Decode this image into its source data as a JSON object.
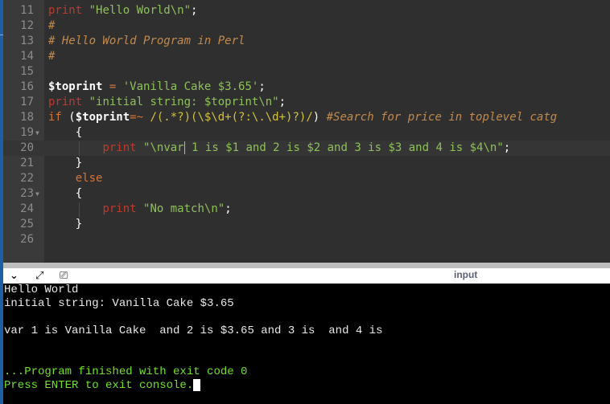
{
  "editor": {
    "lines": [
      {
        "num": "11",
        "tokens": [
          [
            "kw",
            "print"
          ],
          [
            "pl",
            " "
          ],
          [
            "str",
            "\"Hello World\\n\""
          ],
          [
            "pl",
            ";"
          ]
        ]
      },
      {
        "num": "12",
        "tokens": [
          [
            "cm",
            "#"
          ]
        ]
      },
      {
        "num": "13",
        "tokens": [
          [
            "cm",
            "# Hello World Program in Perl"
          ]
        ]
      },
      {
        "num": "14",
        "tokens": [
          [
            "cm",
            "#"
          ]
        ]
      },
      {
        "num": "15",
        "tokens": []
      },
      {
        "num": "16",
        "tokens": [
          [
            "var",
            "$toprint"
          ],
          [
            "pl",
            " "
          ],
          [
            "op",
            "="
          ],
          [
            "pl",
            " "
          ],
          [
            "str",
            "'Vanilla Cake $3.65'"
          ],
          [
            "pl",
            ";"
          ]
        ]
      },
      {
        "num": "17",
        "tokens": [
          [
            "kw",
            "print"
          ],
          [
            "pl",
            " "
          ],
          [
            "str",
            "\"initial string: $toprint\\n\""
          ],
          [
            "pl",
            ";"
          ]
        ]
      },
      {
        "num": "18",
        "tokens": [
          [
            "kw2",
            "if"
          ],
          [
            "pl",
            " ("
          ],
          [
            "var",
            "$toprint"
          ],
          [
            "op",
            "=~"
          ],
          [
            "pl",
            " "
          ],
          [
            "rx",
            "/(.*?)(\\$\\d+(?:\\.\\d+)?)/"
          ],
          [
            "pl",
            ")"
          ],
          [
            "pl",
            " "
          ],
          [
            "cm",
            "#Search for price in toplevel catg"
          ]
        ]
      },
      {
        "num": "19",
        "fold": true,
        "tokens": [
          [
            "pl",
            "    {"
          ]
        ]
      },
      {
        "num": "20",
        "active": true,
        "tokens": [
          [
            "pl",
            "        "
          ],
          [
            "kw",
            "print"
          ],
          [
            "pl",
            " "
          ],
          [
            "str",
            "\"\\nvar"
          ],
          [
            "cursor",
            ""
          ],
          [
            "str",
            " 1 is $1 and 2 is $2 and 3 is $3 and 4 is $4\\n\""
          ],
          [
            "pl",
            ";"
          ]
        ]
      },
      {
        "num": "21",
        "tokens": [
          [
            "pl",
            "    }"
          ]
        ]
      },
      {
        "num": "22",
        "tokens": [
          [
            "pl",
            "    "
          ],
          [
            "kw2",
            "else"
          ]
        ]
      },
      {
        "num": "23",
        "fold": true,
        "tokens": [
          [
            "pl",
            "    {"
          ]
        ]
      },
      {
        "num": "24",
        "tokens": [
          [
            "pl",
            "        "
          ],
          [
            "kw",
            "print"
          ],
          [
            "pl",
            " "
          ],
          [
            "str",
            "\"No match\\n\""
          ],
          [
            "pl",
            ";"
          ]
        ]
      },
      {
        "num": "25",
        "tokens": [
          [
            "pl",
            "    }"
          ]
        ]
      },
      {
        "num": "26",
        "tokens": []
      }
    ]
  },
  "toolbar": {
    "collapse_icon": "chevron-down-icon",
    "expand_icon": "expand-icon",
    "clear_icon": "clear-console-icon",
    "input_label": "input"
  },
  "console": {
    "lines": [
      {
        "text": "Hello World",
        "style": "normal"
      },
      {
        "text": "initial string: Vanilla Cake $3.65",
        "style": "normal"
      },
      {
        "text": "",
        "style": "normal"
      },
      {
        "text": "var 1 is Vanilla Cake  and 2 is $3.65 and 3 is  and 4 is",
        "style": "normal"
      },
      {
        "text": "",
        "style": "normal"
      },
      {
        "text": "",
        "style": "normal"
      },
      {
        "text": "...Program finished with exit code 0",
        "style": "green"
      },
      {
        "text": "Press ENTER to exit console.",
        "style": "green",
        "caret": true
      }
    ]
  }
}
